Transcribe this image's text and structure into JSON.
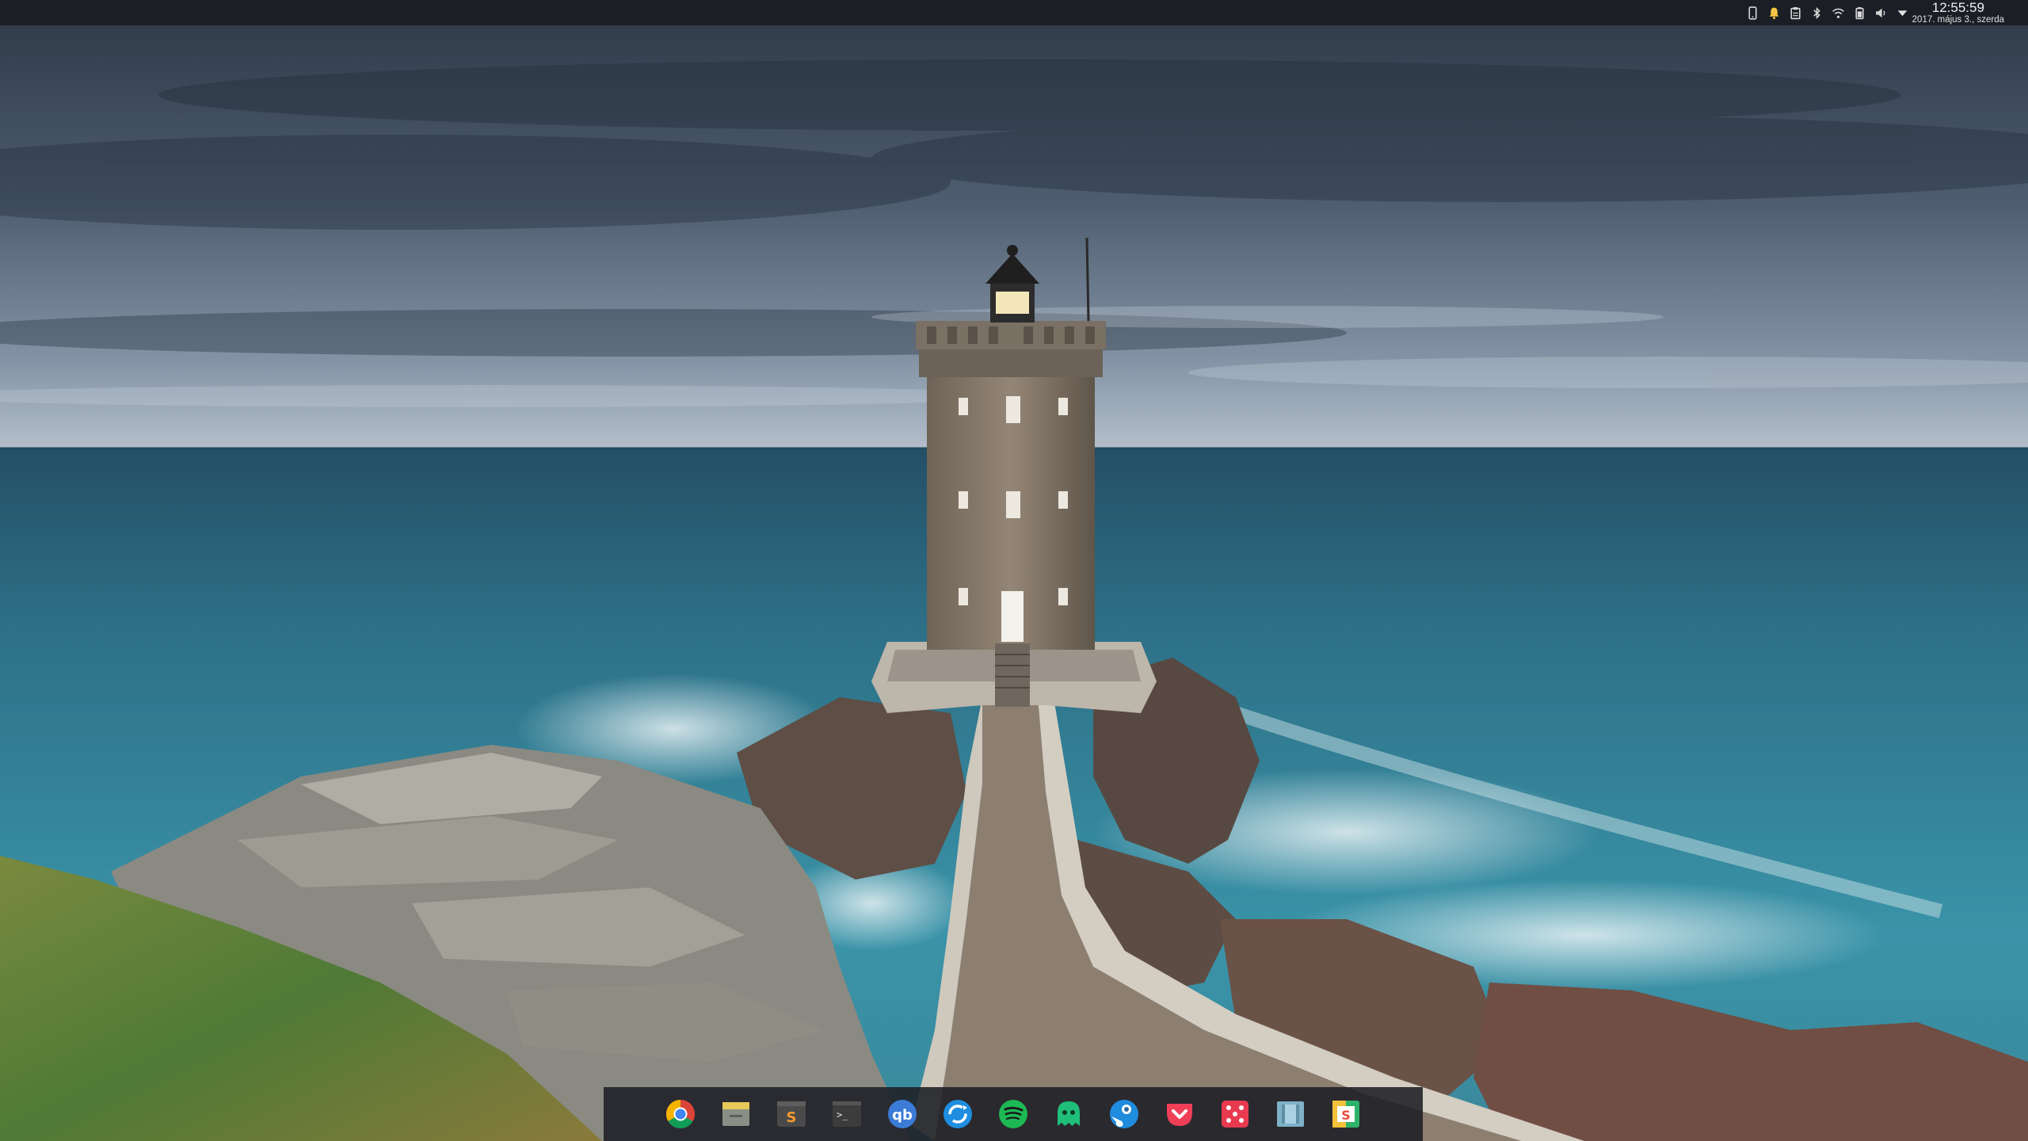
{
  "wallpaper": {
    "subject": "lighthouse-on-rocky-coast",
    "colors": {
      "sky_top": "#3a4656",
      "sky_horizon": "#9aa8b6",
      "sea_far": "#2f6f86",
      "sea_near": "#3f98ad",
      "tower": "#8a7b6c",
      "rock": "#6b5a50",
      "grass": "#5d7a3a"
    }
  },
  "top_panel": {
    "background": "#1b1e24",
    "tray_icons": [
      {
        "name": "phone-icon"
      },
      {
        "name": "bell-icon",
        "color": "#f4c542"
      },
      {
        "name": "clipboard-icon"
      },
      {
        "name": "bluetooth-icon"
      },
      {
        "name": "wifi-icon"
      },
      {
        "name": "battery-icon"
      },
      {
        "name": "volume-icon"
      },
      {
        "name": "dropdown-arrow-icon"
      }
    ],
    "clock": {
      "time": "12:55:59",
      "date": "2017. május 3., szerda"
    }
  },
  "dock": {
    "items": [
      {
        "name": "chrome-icon",
        "app": "Google Chrome"
      },
      {
        "name": "files-icon",
        "app": "Files"
      },
      {
        "name": "sublime-text-icon",
        "app": "Sublime Text",
        "letter": "S"
      },
      {
        "name": "terminal-icon",
        "app": "Terminal",
        "glyph": ">_"
      },
      {
        "name": "qbittorrent-icon",
        "app": "qBittorrent",
        "letter": "qb"
      },
      {
        "name": "sync-icon",
        "app": "Sync"
      },
      {
        "name": "spotify-icon",
        "app": "Spotify"
      },
      {
        "name": "ghost-icon",
        "app": "Ghost"
      },
      {
        "name": "steam-icon",
        "app": "Steam"
      },
      {
        "name": "pocket-icon",
        "app": "Pocket"
      },
      {
        "name": "dice-icon",
        "app": "Dice"
      },
      {
        "name": "image-viewer-icon",
        "app": "Image Viewer"
      },
      {
        "name": "slides-icon",
        "app": "Slides",
        "letter": "S"
      }
    ]
  }
}
